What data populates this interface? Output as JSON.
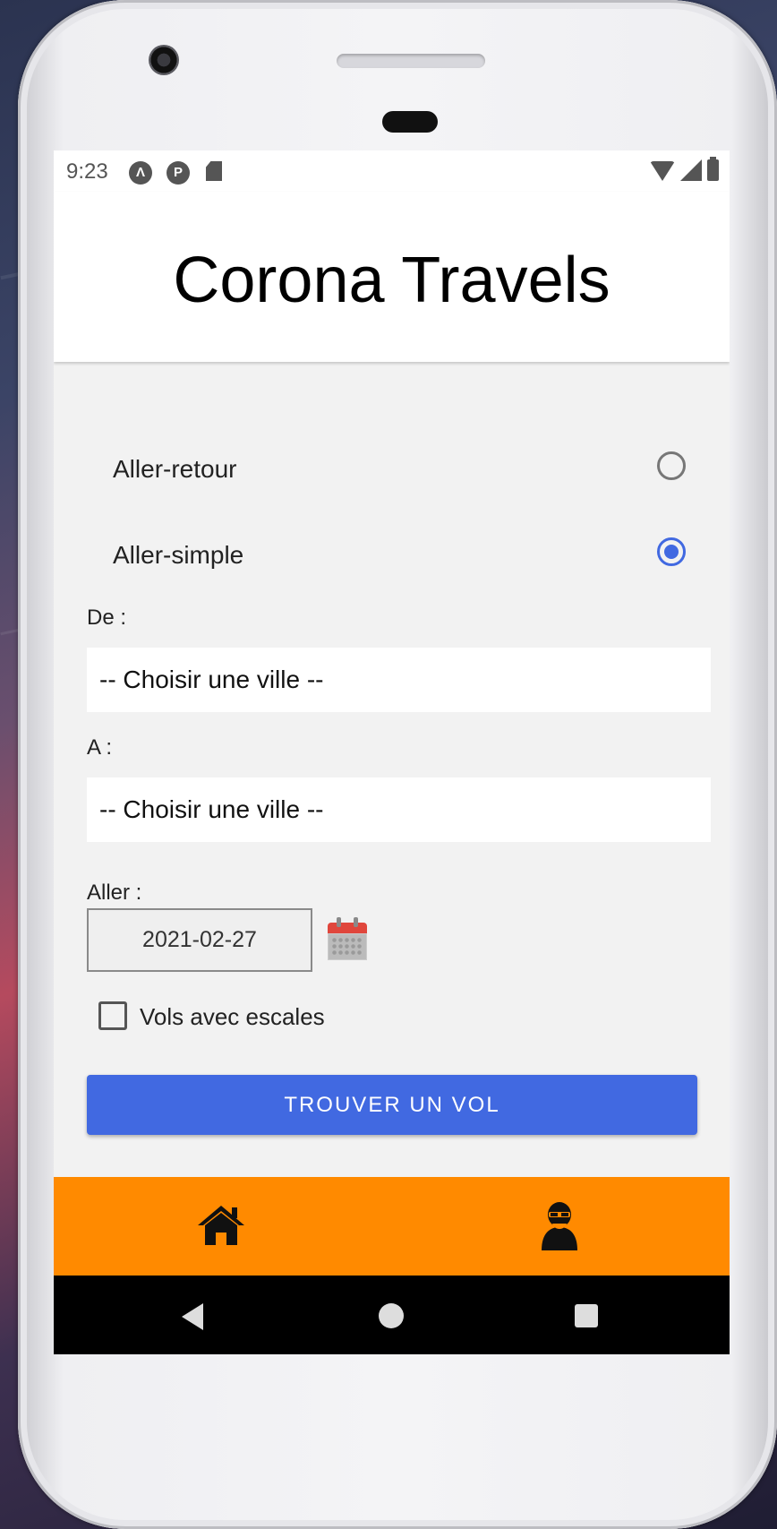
{
  "status_bar": {
    "time": "9:23",
    "icons": [
      "notification-a-icon",
      "notification-p-icon",
      "sd-card-icon",
      "wifi-icon",
      "signal-icon",
      "battery-icon"
    ]
  },
  "header": {
    "title": "Corona Travels"
  },
  "trip_type": {
    "options": [
      {
        "label": "Aller-retour",
        "selected": false
      },
      {
        "label": "Aller-simple",
        "selected": true
      }
    ]
  },
  "from": {
    "label": "De :",
    "value": "-- Choisir une ville --"
  },
  "to": {
    "label": "A :",
    "value": "-- Choisir une ville --"
  },
  "departure": {
    "label": "Aller :",
    "date": "2021-02-27",
    "icon": "calendar-icon"
  },
  "stopovers": {
    "label": "Vols avec escales",
    "checked": false
  },
  "search_button": {
    "label": "TROUVER UN VOL"
  },
  "bottom_nav": {
    "items": [
      {
        "icon": "home-icon"
      },
      {
        "icon": "profile-icon"
      }
    ]
  },
  "system_nav": {
    "icons": [
      "back-icon",
      "home-circle-icon",
      "recent-apps-icon"
    ]
  },
  "colors": {
    "accent": "#4169e1",
    "nav_background": "#ff8a00"
  }
}
